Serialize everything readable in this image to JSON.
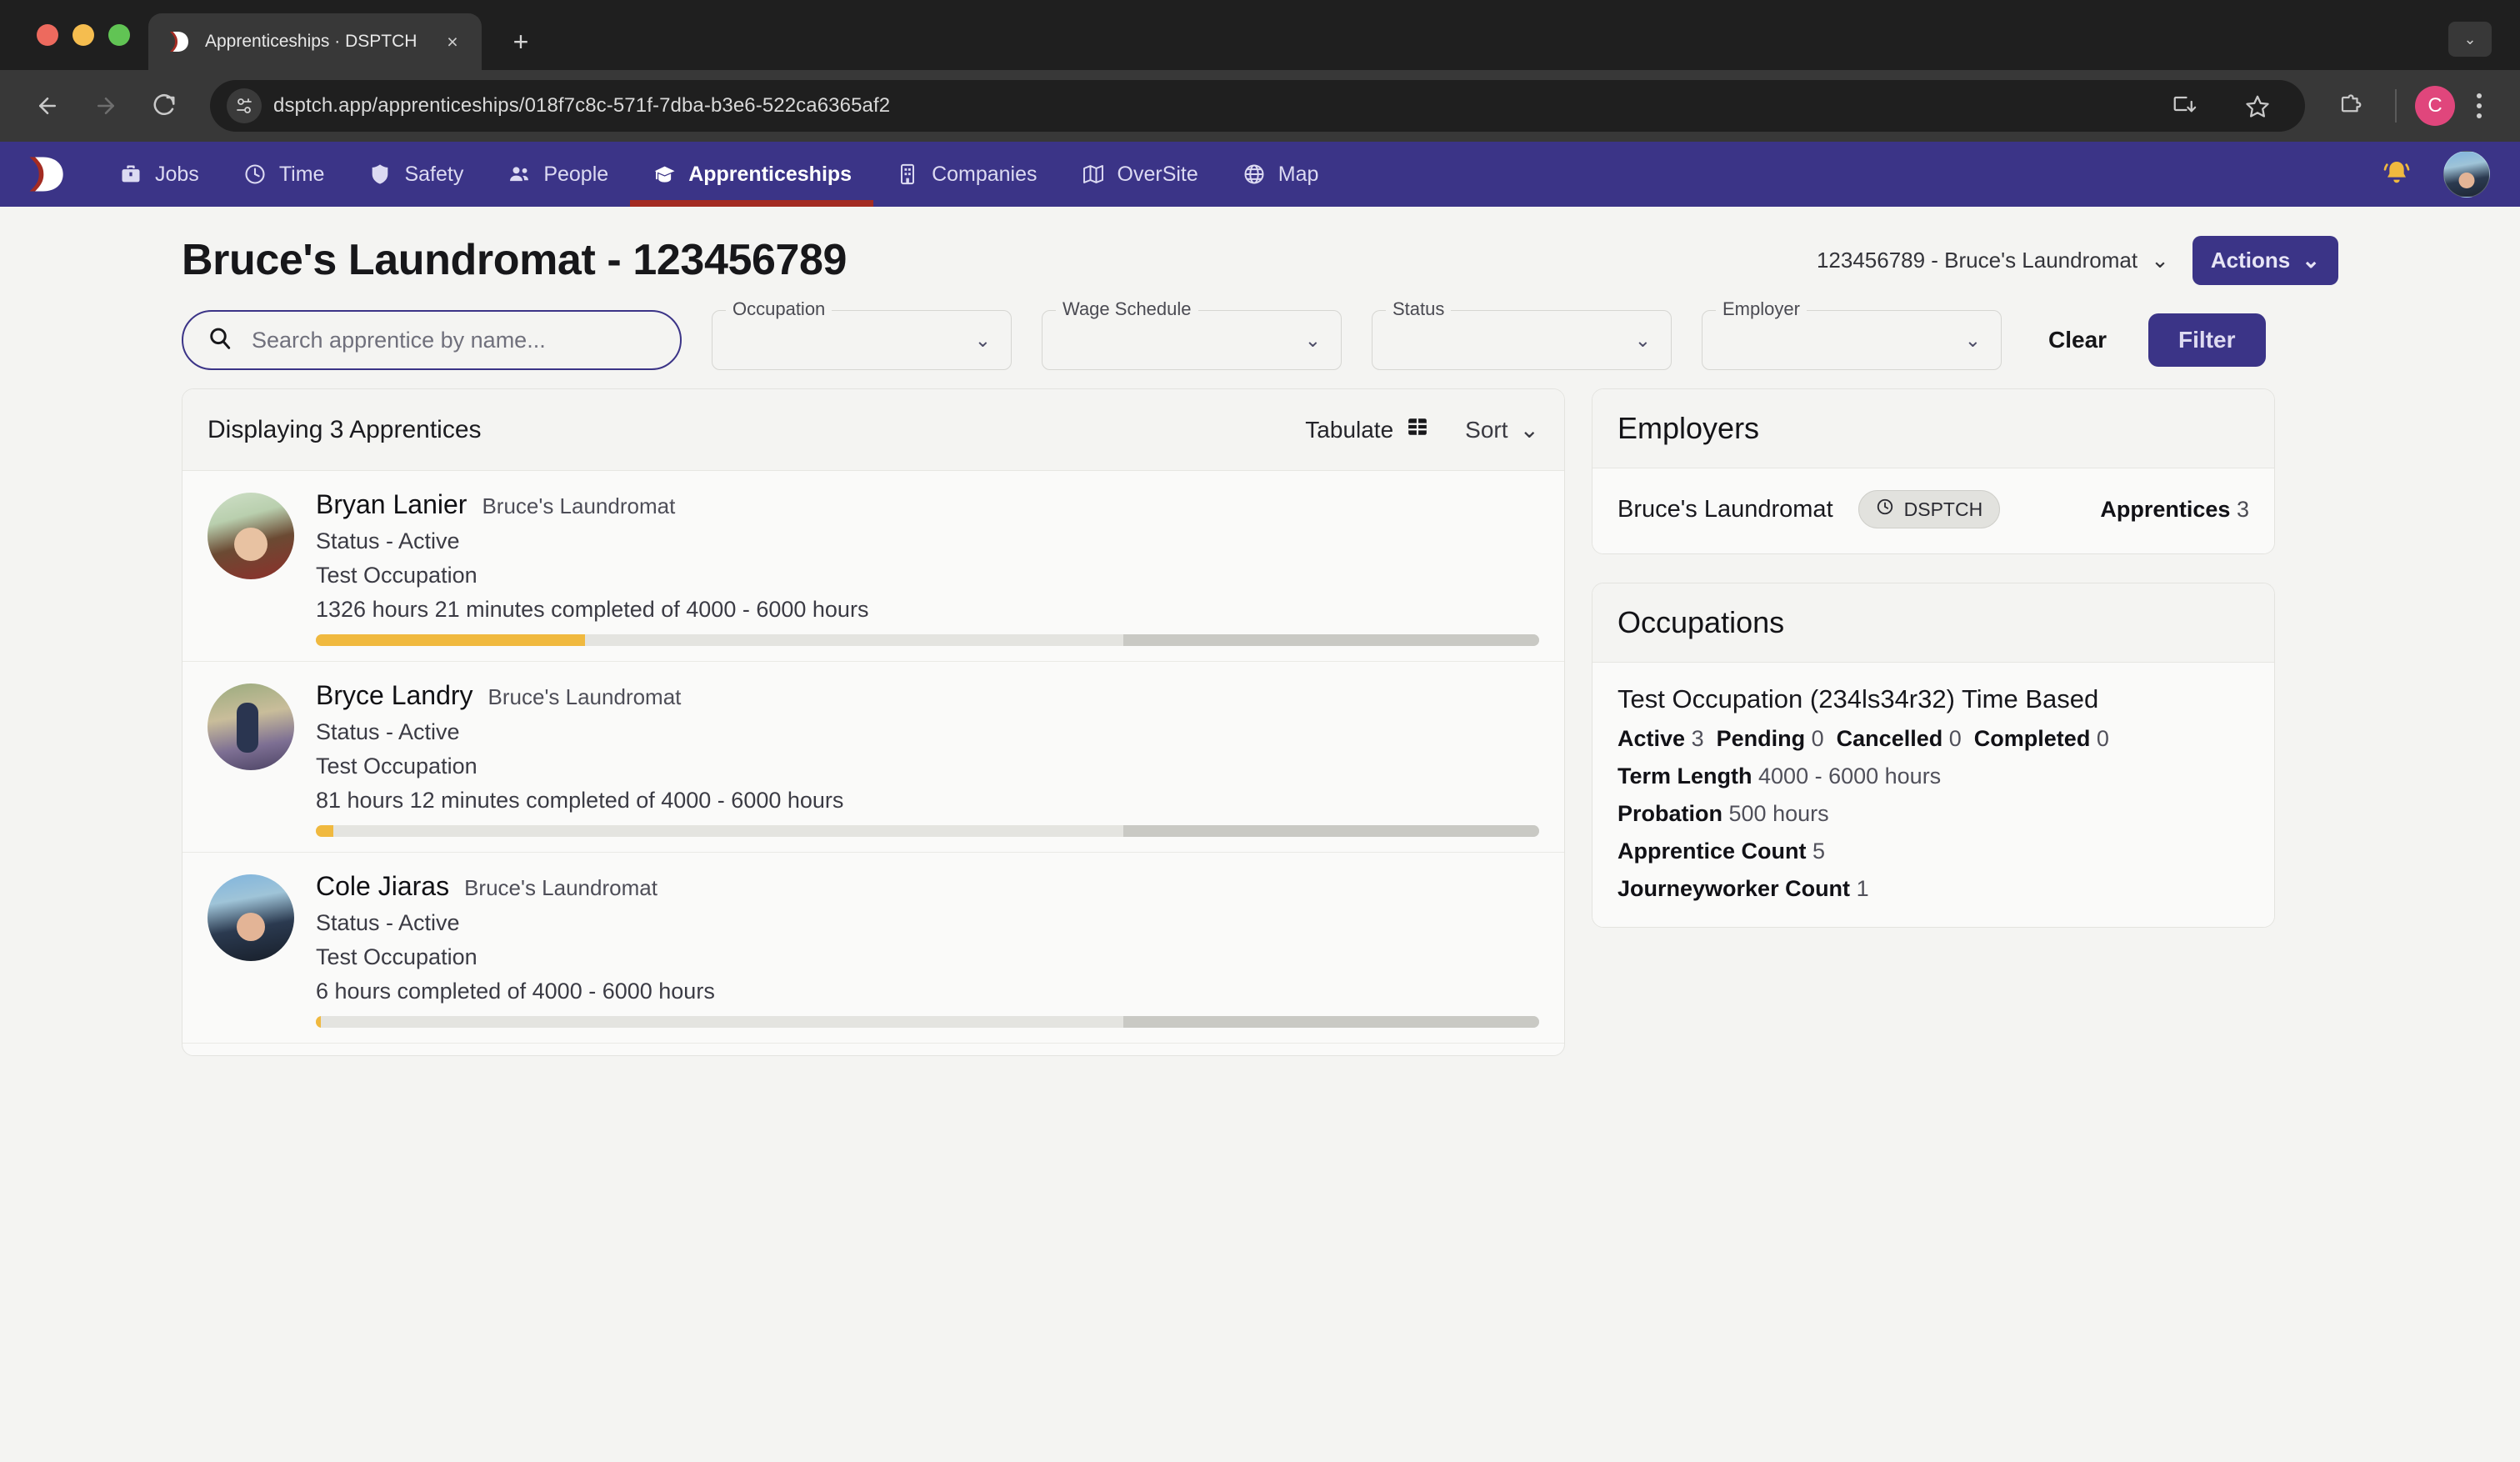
{
  "browser": {
    "tab": {
      "title": "Apprenticeships · DSPTCH",
      "favicon": "dsptch-logo-icon",
      "close": "×"
    },
    "new_tab": "+",
    "url": "dsptch.app/apprenticeships/018f7c8c-571f-7dba-b3e6-522ca6365af2",
    "profile_initial": "C",
    "icons": {
      "back": "back-arrow-icon",
      "forward": "forward-arrow-icon",
      "reload": "reload-icon",
      "site_info": "site-settings-icon",
      "install": "install-app-icon",
      "bookmark": "star-icon",
      "extensions": "extensions-puzzle-icon",
      "menu": "kebab-menu-icon"
    }
  },
  "nav": {
    "brand": "dsptch-logo-icon",
    "items": [
      {
        "label": "Jobs",
        "icon": "briefcase-icon",
        "active": false
      },
      {
        "label": "Time",
        "icon": "clock-icon",
        "active": false
      },
      {
        "label": "Safety",
        "icon": "shield-icon",
        "active": false
      },
      {
        "label": "People",
        "icon": "people-icon",
        "active": false
      },
      {
        "label": "Apprenticeships",
        "icon": "graduation-cap-icon",
        "active": true
      },
      {
        "label": "Companies",
        "icon": "building-icon",
        "active": false
      },
      {
        "label": "OverSite",
        "icon": "map-fold-icon",
        "active": false
      },
      {
        "label": "Map",
        "icon": "globe-icon",
        "active": false
      }
    ],
    "notifications_icon": "bell-icon",
    "avatar": "user-avatar"
  },
  "header": {
    "title": "Bruce's Laundromat - 123456789",
    "entity_selector": "123456789 - Bruce's Laundromat",
    "actions_label": "Actions"
  },
  "filters": {
    "search_placeholder": "Search apprentice by name...",
    "search_value": "",
    "selects": [
      {
        "label": "Occupation",
        "value": ""
      },
      {
        "label": "Wage Schedule",
        "value": ""
      },
      {
        "label": "Status",
        "value": ""
      },
      {
        "label": "Employer",
        "value": ""
      }
    ],
    "clear_label": "Clear",
    "filter_label": "Filter"
  },
  "list": {
    "count_text": "Displaying 3 Apprentices",
    "tabulate_label": "Tabulate",
    "sort_label": "Sort",
    "apprentices": [
      {
        "name": "Bryan Lanier",
        "employer": "Bruce's Laundromat",
        "status": "Status - Active",
        "occupation": "Test Occupation",
        "hours_text": "1326 hours 21 minutes completed of 4000 - 6000 hours",
        "progress_pct": 22,
        "mid_pct": 44
      },
      {
        "name": "Bryce Landry",
        "employer": "Bruce's Laundromat",
        "status": "Status - Active",
        "occupation": "Test Occupation",
        "hours_text": "81 hours 12 minutes completed of 4000 - 6000 hours",
        "progress_pct": 1.4,
        "mid_pct": 64.6
      },
      {
        "name": "Cole Jiaras",
        "employer": "Bruce's Laundromat",
        "status": "Status - Active",
        "occupation": "Test Occupation",
        "hours_text": "6 hours completed of 4000 - 6000 hours",
        "progress_pct": 0.4,
        "mid_pct": 65.6
      }
    ]
  },
  "employers": {
    "title": "Employers",
    "rows": [
      {
        "name": "Bruce's Laundromat",
        "chip_label": "DSPTCH",
        "chip_icon": "clock-icon",
        "count_label": "Apprentices",
        "count_value": "3"
      }
    ]
  },
  "occupations": {
    "title": "Occupations",
    "name": "Test Occupation (234ls34r32) Time Based",
    "status_counts": [
      {
        "label": "Active",
        "value": "3"
      },
      {
        "label": "Pending",
        "value": "0"
      },
      {
        "label": "Cancelled",
        "value": "0"
      },
      {
        "label": "Completed",
        "value": "0"
      }
    ],
    "details": [
      {
        "label": "Term Length",
        "value": "4000 - 6000 hours"
      },
      {
        "label": "Probation",
        "value": "500 hours"
      },
      {
        "label": "Apprentice Count",
        "value": "5"
      },
      {
        "label": "Journeyworker Count",
        "value": "1"
      }
    ]
  },
  "colors": {
    "brand_purple": "#3b3487",
    "active_underline": "#a32b22",
    "progress_yellow": "#f0b93f",
    "page_bg": "#f4f4f2",
    "card_bg": "#fafaf9"
  }
}
